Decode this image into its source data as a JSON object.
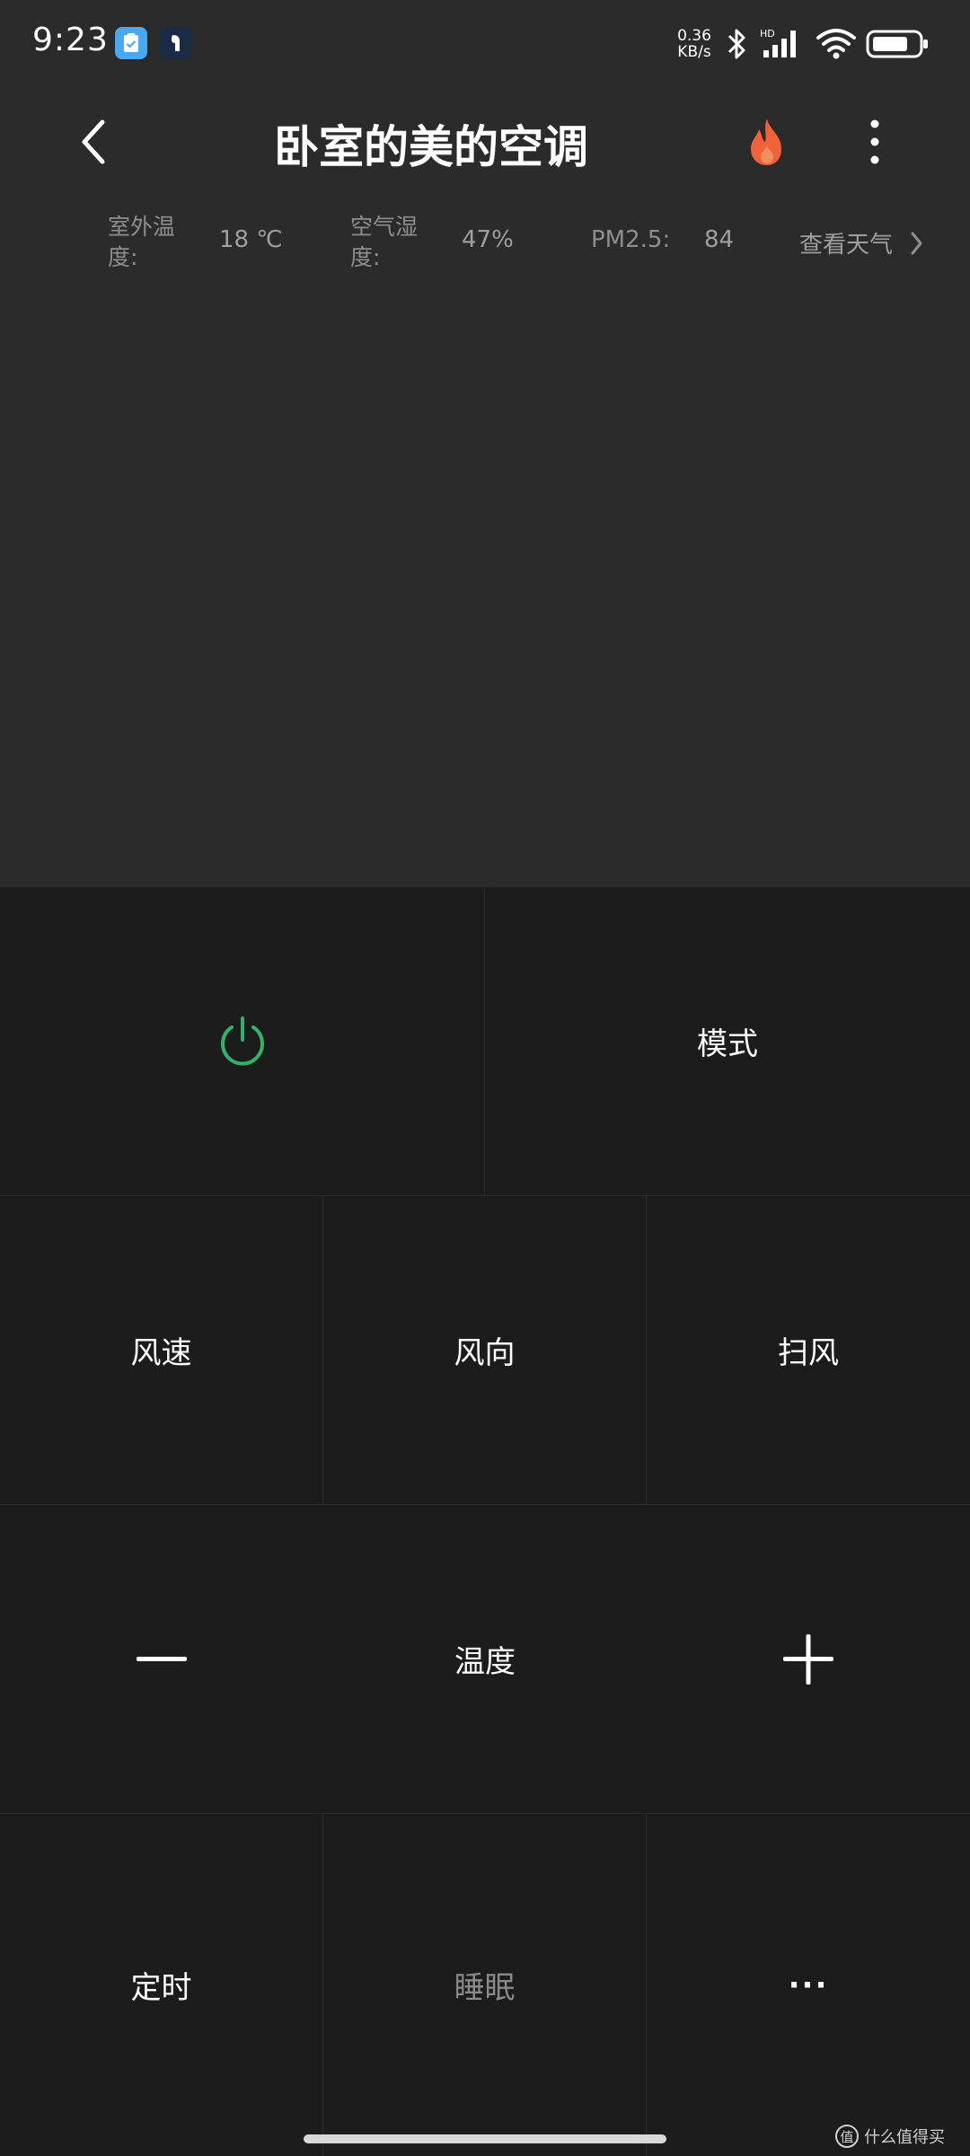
{
  "status_bar": {
    "time": "9:23",
    "net_speed_value": "0.36",
    "net_speed_unit": "KB/s",
    "signal_label": "HD"
  },
  "header": {
    "title": "卧室的美的空调"
  },
  "info": {
    "outdoor_temp_label_1": "室外温",
    "outdoor_temp_label_2": "度:",
    "outdoor_temp_value": "18 ℃",
    "humidity_label_1": "空气湿",
    "humidity_label_2": "度:",
    "humidity_value": "47%",
    "pm_label": "PM2.5:",
    "pm_value": "84",
    "weather_link": "查看天气"
  },
  "controls": {
    "mode_label": "模式",
    "fan_speed_label": "风速",
    "fan_direction_label": "风向",
    "swing_label": "扫风",
    "temperature_label": "温度",
    "timer_label": "定时",
    "sleep_label": "睡眠",
    "more_label": "···"
  },
  "watermark": {
    "badge": "值",
    "text": "什么值得买"
  },
  "colors": {
    "power_accent": "#2fb56a",
    "fire_accent": "#f0633a",
    "panel_bg": "#1c1c1c",
    "top_bg": "#2b2b2b"
  }
}
